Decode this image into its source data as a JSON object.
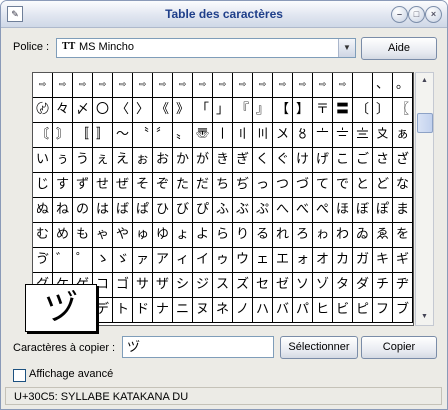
{
  "window": {
    "title": "Table des caractères"
  },
  "font": {
    "label": "Police :",
    "value": "MS Mincho",
    "type_icon": "TT"
  },
  "buttons": {
    "help": "Aide",
    "select": "Sélectionner",
    "copy": "Copier"
  },
  "grid_rows": [
    [
      "⇨",
      "⇨",
      "⇨",
      "⇨",
      "⇨",
      "⇨",
      "⇨",
      "⇨",
      "⇨",
      "⇨",
      "⇨",
      "⇨",
      "⇨",
      "⇨",
      "⇨",
      "⇨",
      "",
      "、",
      "。",
      "〃"
    ],
    [
      "〄",
      "々",
      "〆",
      "〇",
      "〈",
      "〉",
      "《",
      "》",
      "「",
      "」",
      "『",
      "』",
      "【",
      "】",
      "〒",
      "〓",
      "〔",
      "〕",
      "〖",
      "〗"
    ],
    [
      "〘",
      "〙",
      "〚",
      "〛",
      "〜",
      "〝",
      "〞",
      "〟",
      "〠",
      "〡",
      "〢",
      "〣",
      "〤",
      "〥",
      "〦",
      "〧",
      "〨",
      "〩",
      "ぁ",
      "あ"
    ],
    [
      "い",
      "ぅ",
      "う",
      "ぇ",
      "え",
      "ぉ",
      "お",
      "か",
      "が",
      "き",
      "ぎ",
      "く",
      "ぐ",
      "け",
      "げ",
      "こ",
      "ご",
      "さ",
      "ざ",
      "し"
    ],
    [
      "じ",
      "す",
      "ず",
      "せ",
      "ぜ",
      "そ",
      "ぞ",
      "た",
      "だ",
      "ち",
      "ぢ",
      "っ",
      "つ",
      "づ",
      "て",
      "で",
      "と",
      "ど",
      "な",
      "に"
    ],
    [
      "ぬ",
      "ね",
      "の",
      "は",
      "ば",
      "ぱ",
      "ひ",
      "び",
      "ぴ",
      "ふ",
      "ぶ",
      "ぷ",
      "へ",
      "べ",
      "ぺ",
      "ほ",
      "ぼ",
      "ぽ",
      "ま",
      "み"
    ],
    [
      "む",
      "め",
      "も",
      "ゃ",
      "や",
      "ゅ",
      "ゆ",
      "ょ",
      "よ",
      "ら",
      "り",
      "る",
      "れ",
      "ろ",
      "ゎ",
      "わ",
      "ゐ",
      "ゑ",
      "を",
      "ん"
    ],
    [
      "ゔ",
      "゛",
      "゜",
      "ゝ",
      "ゞ",
      "ァ",
      "ア",
      "ィ",
      "イ",
      "ゥ",
      "ウ",
      "ェ",
      "エ",
      "ォ",
      "オ",
      "カ",
      "ガ",
      "キ",
      "ギ",
      "ク"
    ],
    [
      "グ",
      "ケ",
      "ゲ",
      "コ",
      "ゴ",
      "サ",
      "ザ",
      "シ",
      "ジ",
      "ス",
      "ズ",
      "セ",
      "ゼ",
      "ソ",
      "ゾ",
      "タ",
      "ダ",
      "チ",
      "ヂ",
      "ッ"
    ],
    [
      "ツ",
      "ヅ",
      "テ",
      "デ",
      "ト",
      "ド",
      "ナ",
      "ニ",
      "ヌ",
      "ネ",
      "ノ",
      "ハ",
      "バ",
      "パ",
      "ヒ",
      "ビ",
      "ピ",
      "フ",
      "ブ",
      "プ"
    ]
  ],
  "zoom_char": "ヅ",
  "copy_field": {
    "label": "Caractères à copier :",
    "value": "ヅ"
  },
  "advanced": {
    "label": "Affichage avancé",
    "checked": false
  },
  "status": "U+30C5: SYLLABE KATAKANA DU"
}
